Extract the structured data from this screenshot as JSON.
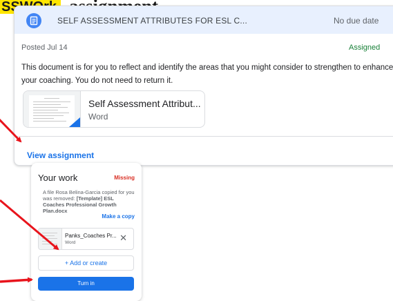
{
  "banner": {
    "label": "SSWOrk",
    "title": "assignment."
  },
  "assignment": {
    "title": "SELF ASSESSMENT ATTRIBUTES FOR ESL C...",
    "due": "No due date",
    "posted": "Posted Jul 14",
    "status": "Assigned",
    "description": "This document is for you to reflect and identify the areas that you might consider to strengthen to enhance your coaching. You do not need to return it.",
    "attachment": {
      "title": "Self Assessment Attribut...",
      "type": "Word"
    },
    "view_link": "View assignment",
    "icon": "document-icon"
  },
  "your_work": {
    "title": "Your work",
    "status": "Missing",
    "notice_prefix": "A file Rosa Belina-Garcia copied for you was removed: ",
    "notice_file": "[Template] ESL Coaches Professional Growth Plan.docx",
    "make_copy": "Make a copy",
    "file": {
      "name": "Panks_Coaches Pr...",
      "type": "Word"
    },
    "remove_icon": "close-icon",
    "add_label": "+ Add or create",
    "turn_in": "Turn in"
  },
  "colors": {
    "accent": "#1a73e8",
    "assigned": "#188038",
    "missing": "#d93025",
    "highlight": "#ffe600",
    "arrow": "#e8141c"
  }
}
